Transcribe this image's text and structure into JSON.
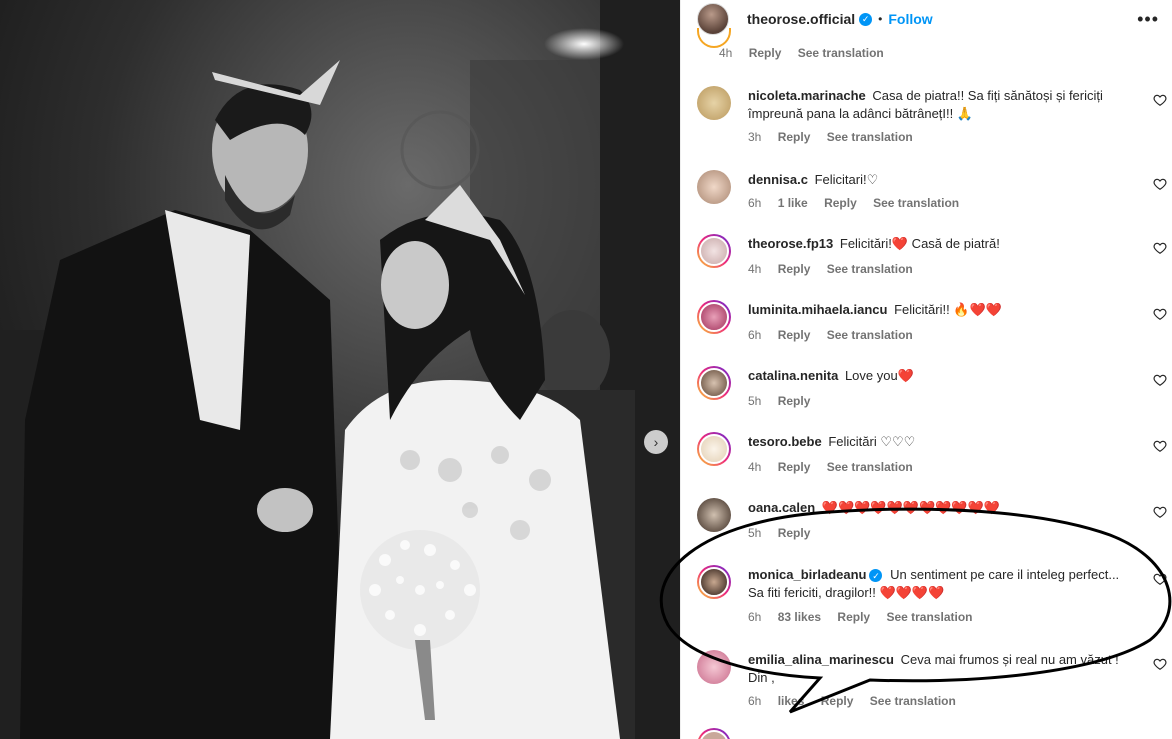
{
  "post": {
    "username": "theorose.official",
    "verified_mark": "✓",
    "separator": "•",
    "follow_label": "Follow",
    "more_label": "•••",
    "next_arrow": "›"
  },
  "cut_comment": {
    "time": "4h",
    "reply": "Reply",
    "translate": "See translation"
  },
  "comments": [
    {
      "user": "nicoleta.marinache",
      "text": "Casa de piatra!! Sa fiți sănătoși și fericiți împreună pana la adânci bătrânețI!! 🙏",
      "time": "3h",
      "likes": "",
      "reply": "Reply",
      "translate": "See translation"
    },
    {
      "user": "dennisa.c",
      "text": "Felicitari!♡",
      "time": "6h",
      "likes": "1 like",
      "reply": "Reply",
      "translate": "See translation"
    },
    {
      "user": "theorose.fp13",
      "text": "Felicitări!❤️ Casă de piatră!",
      "time": "4h",
      "likes": "",
      "reply": "Reply",
      "translate": "See translation"
    },
    {
      "user": "luminita.mihaela.iancu",
      "text": "Felicitări!! 🔥❤️❤️",
      "time": "6h",
      "likes": "",
      "reply": "Reply",
      "translate": "See translation"
    },
    {
      "user": "catalina.nenita",
      "text": "Love you❤️",
      "time": "5h",
      "likes": "",
      "reply": "Reply",
      "translate": ""
    },
    {
      "user": "tesoro.bebe",
      "text": "Felicitări ♡♡♡",
      "time": "4h",
      "likes": "",
      "reply": "Reply",
      "translate": "See translation"
    },
    {
      "user": "oana.calen",
      "text": "❤️❤️❤️❤️❤️❤️❤️❤️❤️❤️❤️",
      "time": "5h",
      "likes": "",
      "reply": "Reply",
      "translate": ""
    },
    {
      "user": "monica_birladeanu",
      "text": "Un sentiment pe care il inteleg perfect... Sa fiti fericiti, dragilor!! ❤️❤️❤️❤️",
      "time": "6h",
      "likes": "83 likes",
      "reply": "Reply",
      "translate": "See translation"
    },
    {
      "user": "emilia_alina_marinescu",
      "text": "Ceva mai frumos și real nu am văzut ! Din ,",
      "time": "6h",
      "likes": "likes",
      "reply": "Reply",
      "translate": "See translation"
    }
  ],
  "colors": {
    "link": "#0095f6",
    "text": "#262626",
    "muted": "#737373",
    "heart": "#ed4956"
  }
}
